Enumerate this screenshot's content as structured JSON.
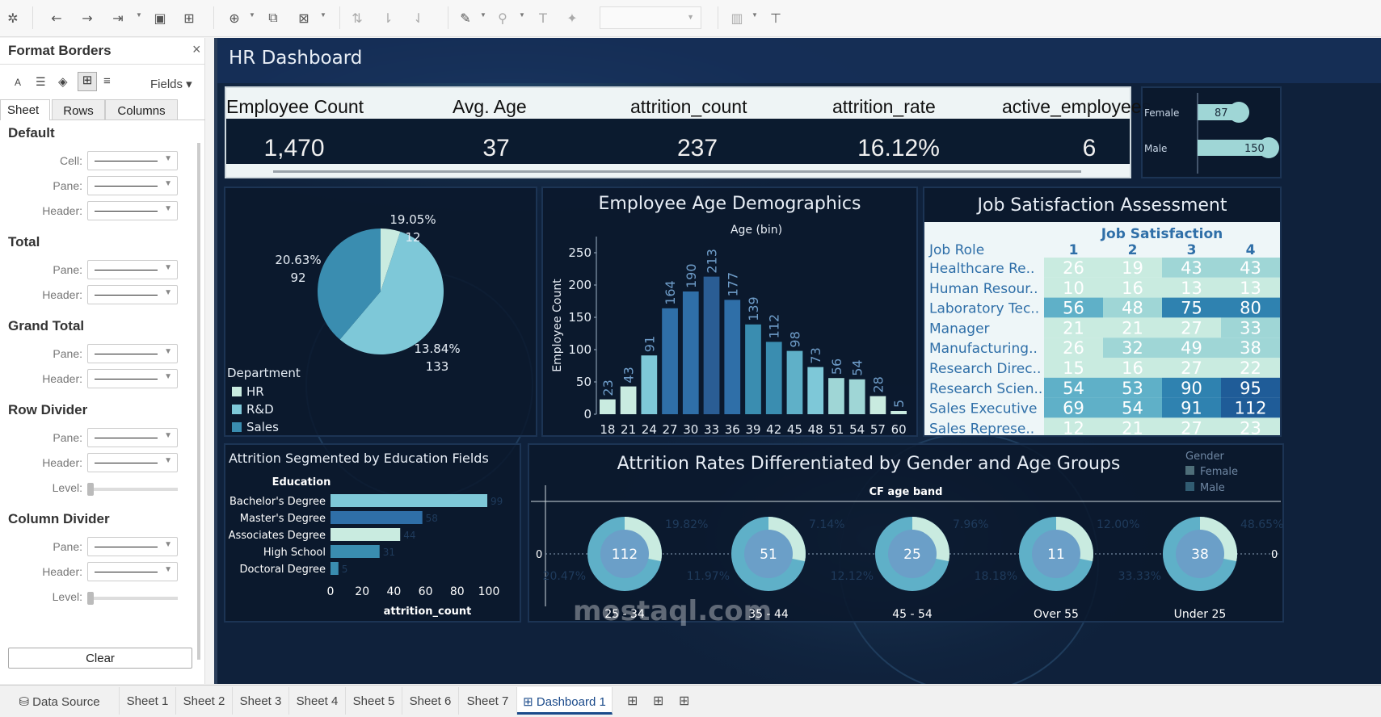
{
  "toolbar": {
    "icons": [
      "tableau-logo-icon",
      "undo-icon",
      "redo-icon",
      "swap-icon",
      "save-icon",
      "new-datasource-icon",
      "new-sheet-icon",
      "duplicate-icon",
      "clear-sheet-icon",
      "swap-rows-icon",
      "sort-asc-icon",
      "sort-desc-icon",
      "highlight-icon",
      "group-icon",
      "label-icon",
      "pin-icon",
      "show-cards-icon",
      "presentation-icon"
    ]
  },
  "panel": {
    "title": "Format Borders",
    "close": "×",
    "fields_label": "Fields",
    "tabs": [
      "Sheet",
      "Rows",
      "Columns"
    ],
    "sections": [
      {
        "title": "Default",
        "rows": [
          "Cell:",
          "Pane:",
          "Header:"
        ]
      },
      {
        "title": "Total",
        "rows": [
          "Pane:",
          "Header:"
        ]
      },
      {
        "title": "Grand Total",
        "rows": [
          "Pane:",
          "Header:"
        ]
      },
      {
        "title": "Row Divider",
        "rows": [
          "Pane:",
          "Header:"
        ],
        "level": "Level:"
      },
      {
        "title": "Column Divider",
        "rows": [
          "Pane:",
          "Header:"
        ],
        "level": "Level:"
      }
    ],
    "clear_label": "Clear"
  },
  "dashboard": {
    "title": "HR Dashboard",
    "kpis": [
      {
        "label": "Employee Count",
        "value": "1,470"
      },
      {
        "label": "Avg. Age",
        "value": "37"
      },
      {
        "label": "attrition_count",
        "value": "237"
      },
      {
        "label": "attrition_rate",
        "value": "16.12%"
      },
      {
        "label": "active_employees",
        "value": "6"
      }
    ],
    "gender_bars": [
      {
        "label": "Female",
        "value": 87
      },
      {
        "label": "Male",
        "value": 150
      }
    ]
  },
  "chart_data": [
    {
      "type": "pie",
      "legend_title": "Department",
      "categories": [
        "HR",
        "R&D",
        "Sales"
      ],
      "values": [
        12,
        133,
        92
      ],
      "percent_labels": [
        "19.05%",
        "13.84%",
        "20.63%"
      ],
      "colors": [
        "#c9ebe0",
        "#7ec8d8",
        "#3a8db0"
      ]
    },
    {
      "type": "bar",
      "title": "Employee Age Demographics",
      "xlabel": "Age (bin)",
      "ylabel": "Employee Count",
      "categories": [
        "18",
        "21",
        "24",
        "27",
        "30",
        "33",
        "36",
        "39",
        "42",
        "45",
        "48",
        "51",
        "54",
        "57",
        "60"
      ],
      "values": [
        23,
        43,
        91,
        164,
        190,
        213,
        177,
        139,
        112,
        98,
        73,
        56,
        54,
        28,
        5
      ],
      "yticks": [
        0,
        50,
        100,
        150,
        200,
        250
      ],
      "ylim": [
        0,
        260
      ]
    },
    {
      "type": "table",
      "title": "Job Satisfaction Assessment",
      "column_header": "Job Satisfaction",
      "row_header": "Job Role",
      "columns": [
        "1",
        "2",
        "3",
        "4"
      ],
      "rows": [
        {
          "role": "Healthcare Re..",
          "values": [
            26,
            19,
            43,
            43
          ]
        },
        {
          "role": "Human Resour..",
          "values": [
            10,
            16,
            13,
            13
          ]
        },
        {
          "role": "Laboratory Tec..",
          "values": [
            56,
            48,
            75,
            80
          ]
        },
        {
          "role": "Manager",
          "values": [
            21,
            21,
            27,
            33
          ]
        },
        {
          "role": "Manufacturing..",
          "values": [
            26,
            32,
            49,
            38
          ]
        },
        {
          "role": "Research Direc..",
          "values": [
            15,
            16,
            27,
            22
          ]
        },
        {
          "role": "Research Scien..",
          "values": [
            54,
            53,
            90,
            95
          ]
        },
        {
          "role": "Sales Executive",
          "values": [
            69,
            54,
            91,
            112
          ]
        },
        {
          "role": "Sales Represe..",
          "values": [
            12,
            21,
            27,
            23
          ]
        }
      ]
    },
    {
      "type": "bar",
      "title": "Attrition Segmented by Education Fields",
      "ylabel": "Education",
      "xlabel": "attrition_count",
      "categories": [
        "Bachelor's Degree",
        "Master's Degree",
        "Associates Degree",
        "High School",
        "Doctoral Degree"
      ],
      "values": [
        99,
        58,
        44,
        31,
        5
      ],
      "xticks": [
        0,
        20,
        40,
        60,
        80,
        100
      ],
      "xlim": [
        0,
        100
      ],
      "colors": [
        "#7ec8d8",
        "#2f6fa8",
        "#c9ebe0",
        "#3a8db0",
        "#3a8db0"
      ]
    },
    {
      "type": "pie",
      "title": "Attrition Rates Differentiated by Gender and Age Groups",
      "xlabel": "CF age band",
      "legend_title": "Gender",
      "legend": [
        "Female",
        "Male"
      ],
      "y_axis_label": "0",
      "groups": [
        {
          "band": "25 - 34",
          "center": "112",
          "labels": [
            "19.82%",
            "20.47%"
          ]
        },
        {
          "band": "35 - 44",
          "center": "51",
          "labels": [
            "7.14%",
            "11.97%"
          ]
        },
        {
          "band": "45 - 54",
          "center": "25",
          "labels": [
            "7.96%",
            "12.12%"
          ]
        },
        {
          "band": "Over 55",
          "center": "11",
          "labels": [
            "12.00%",
            "18.18%"
          ]
        },
        {
          "band": "Under 25",
          "center": "38",
          "labels": [
            "48.65%",
            "33.33%"
          ]
        }
      ]
    }
  ],
  "tabs": [
    "Data Source",
    "Sheet 1",
    "Sheet 2",
    "Sheet 3",
    "Sheet 4",
    "Sheet 5",
    "Sheet 6",
    "Sheet 7",
    "Dashboard 1"
  ],
  "watermark": "mostaql.com"
}
